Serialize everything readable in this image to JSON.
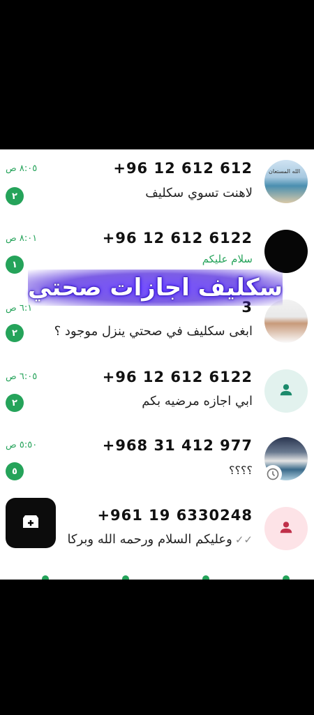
{
  "overlay_title": "سكليف اجازات صحتي",
  "chats": [
    {
      "name": "+96 12 612 612",
      "preview": "لاهنت تسوي سكليف",
      "time": "٨:٠٥ ص",
      "unread": "٢",
      "avatar_caption": "الله المستعان"
    },
    {
      "name": "+96 12 612 6122",
      "preview": "سلام عليكم",
      "time": "٨:٠١ ص",
      "unread": "١"
    },
    {
      "name": "3",
      "preview": "ابغى سكليف في صحتي ينزل موجود ؟",
      "time": "٦:١ ص",
      "unread": "٢"
    },
    {
      "name": "+96 12 612 6122",
      "preview": "ابي اجازه مرضيه بكم",
      "time": "٦:٠٥ ص",
      "unread": "٢"
    },
    {
      "name": "+968 31 412 977",
      "preview": "؟؟؟؟",
      "time": "٥:٥٠ ص",
      "unread": "٥"
    },
    {
      "name": "+961 19 6330248",
      "preview": "وعليكم السلام ورحمه الله وبركا"
    }
  ],
  "colors": {
    "accent": "#25a35a",
    "overlay": "#5a3cf0"
  },
  "icons": {
    "fab": "new-chat-icon",
    "contact": "person-icon",
    "clock": "clock-icon",
    "ticks": "double-check-icon"
  }
}
